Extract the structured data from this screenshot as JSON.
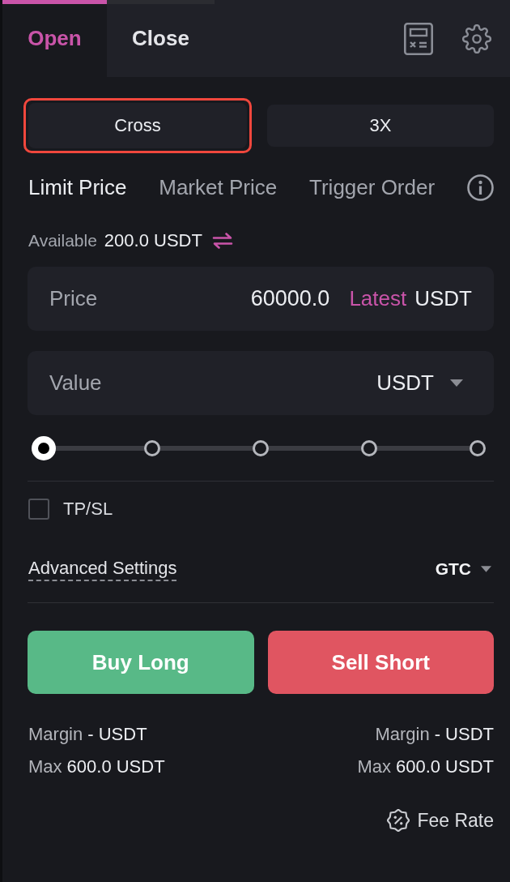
{
  "position_tabs": [
    {
      "label": "Open",
      "selected": true
    },
    {
      "label": "Close",
      "selected": false
    }
  ],
  "margin_mode": {
    "label": "Cross",
    "highlighted": true
  },
  "leverage": {
    "label": "3X"
  },
  "order_types": [
    {
      "label": "Limit Price",
      "selected": true
    },
    {
      "label": "Market Price",
      "selected": false
    },
    {
      "label": "Trigger Order",
      "selected": false
    }
  ],
  "available": {
    "label": "Available",
    "value": "200.0 USDT"
  },
  "price_field": {
    "label": "Price",
    "value": "60000.0",
    "latest": "Latest",
    "unit": "USDT"
  },
  "value_field": {
    "placeholder": "Value",
    "unit": "USDT"
  },
  "amount_slider": {
    "level": 0
  },
  "tpsl": {
    "label": "TP/SL",
    "checked": false
  },
  "advanced_settings": {
    "label": "Advanced Settings",
    "time_in_force": "GTC"
  },
  "actions": [
    {
      "label": "Buy Long",
      "kind": "buy"
    },
    {
      "label": "Sell Short",
      "kind": "sell"
    }
  ],
  "summaries": [
    {
      "margin": {
        "label": "Margin",
        "value": "- USDT"
      },
      "max": {
        "label": "Max",
        "value": "600.0 USDT"
      }
    },
    {
      "margin": {
        "label": "Margin",
        "value": "- USDT"
      },
      "max": {
        "label": "Max",
        "value": "600.0 USDT"
      }
    }
  ],
  "fee_rate": {
    "label": "Fee Rate"
  }
}
